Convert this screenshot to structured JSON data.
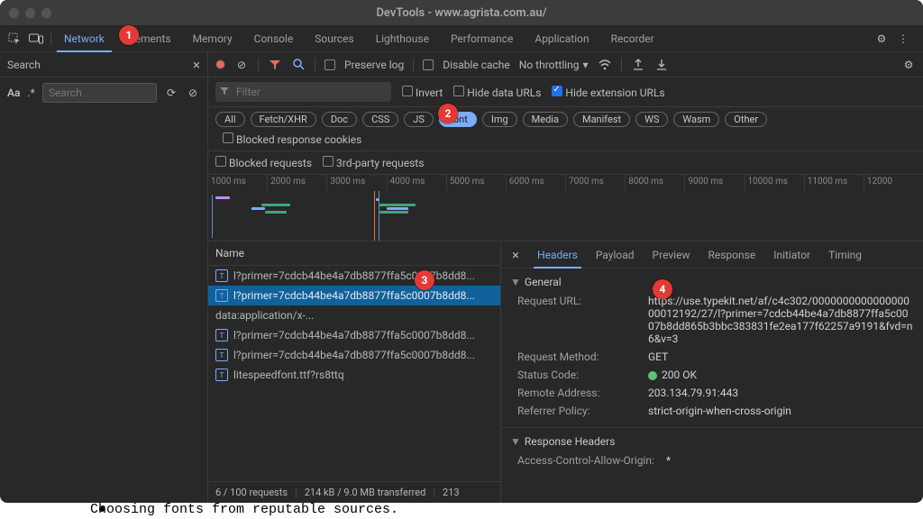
{
  "window": {
    "title": "DevTools - www.agrista.com.au/"
  },
  "tabs": [
    "Network",
    "Elements",
    "Memory",
    "Console",
    "Sources",
    "Lighthouse",
    "Performance",
    "Application",
    "Recorder"
  ],
  "active_tab": "Network",
  "sidebar": {
    "title": "Search",
    "match_case": "Aa",
    "regex": ".*",
    "placeholder": "Search"
  },
  "toolbar": {
    "preserve_log": "Preserve log",
    "disable_cache": "Disable cache",
    "throttling": "No throttling"
  },
  "filterbar": {
    "placeholder": "Filter",
    "invert": "Invert",
    "hide_data": "Hide data URLs",
    "hide_ext": "Hide extension URLs"
  },
  "type_filters": [
    "All",
    "Fetch/XHR",
    "Doc",
    "CSS",
    "JS",
    "Font",
    "Img",
    "Media",
    "Manifest",
    "WS",
    "Wasm",
    "Other"
  ],
  "active_type": "Font",
  "extra_filters": {
    "blocked_cookies": "Blocked response cookies",
    "blocked_req": "Blocked requests",
    "third_party": "3rd-party requests"
  },
  "timeline_ticks": [
    "1000 ms",
    "2000 ms",
    "3000 ms",
    "4000 ms",
    "5000 ms",
    "6000 ms",
    "7000 ms",
    "8000 ms",
    "9000 ms",
    "10000 ms",
    "11000 ms",
    "12000"
  ],
  "requests": {
    "header": "Name",
    "rows": [
      {
        "name": "l?primer=7cdcb44be4a7db8877ffa5c0007b8dd8...",
        "sel": false,
        "icon": true
      },
      {
        "name": "l?primer=7cdcb44be4a7db8877ffa5c0007b8dd8...",
        "sel": true,
        "icon": true
      },
      {
        "name": "data:application/x-...",
        "sel": false,
        "icon": false
      },
      {
        "name": "l?primer=7cdcb44be4a7db8877ffa5c0007b8dd8...",
        "sel": false,
        "icon": true
      },
      {
        "name": "l?primer=7cdcb44be4a7db8877ffa5c0007b8dd8...",
        "sel": false,
        "icon": true
      },
      {
        "name": "litespeedfont.ttf?rs8ttq",
        "sel": false,
        "icon": true
      }
    ]
  },
  "statusbar": {
    "count": "6 / 100 requests",
    "transfer": "214 kB / 9.0 MB transferred",
    "res": "213"
  },
  "detail_tabs": [
    "Headers",
    "Payload",
    "Preview",
    "Response",
    "Initiator",
    "Timing"
  ],
  "active_detail": "Headers",
  "headers": {
    "general_title": "General",
    "url_k": "Request URL:",
    "url_v": "https://use.typekit.net/af/c4c302/000000000000000000012192/27/l?primer=7cdcb44be4a7db8877ffa5c0007b8dd865b3bbc383831fe2ea177f62257a9191&fvd=n6&v=3",
    "method_k": "Request Method:",
    "method_v": "GET",
    "status_k": "Status Code:",
    "status_v": "200 OK",
    "remote_k": "Remote Address:",
    "remote_v": "203.134.79.91:443",
    "refpol_k": "Referrer Policy:",
    "refpol_v": "strict-origin-when-cross-origin",
    "resp_title": "Response Headers",
    "acao_k": "Access-Control-Allow-Origin:",
    "acao_v": "*"
  },
  "badges": {
    "1": "1",
    "2": "2",
    "3": "3",
    "4": "4"
  },
  "caption": "Choosing fonts from reputable sources."
}
